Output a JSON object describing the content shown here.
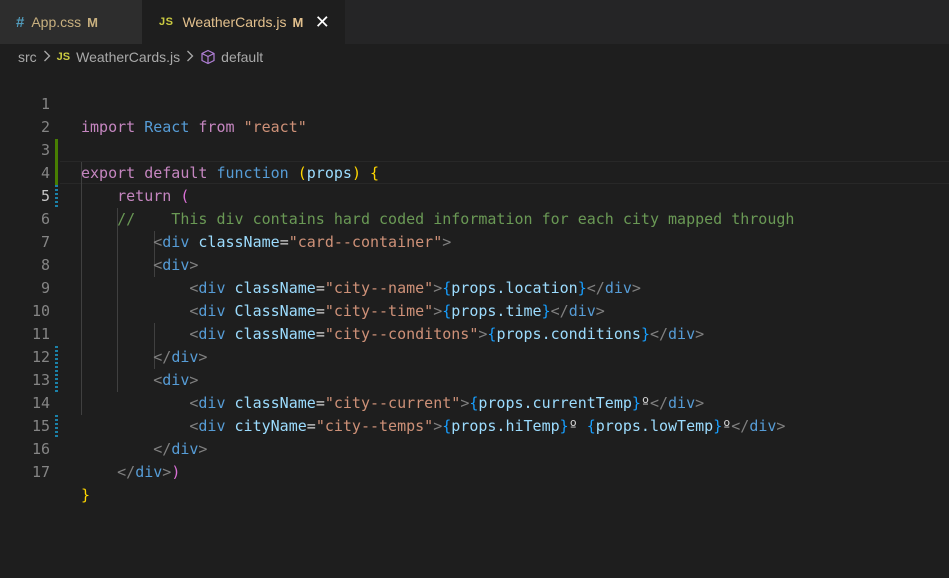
{
  "tabs": [
    {
      "icon": "css-file-icon",
      "glyph": "#",
      "name": "App.css",
      "status": "M",
      "active": false
    },
    {
      "icon": "js-file-icon",
      "glyph": "JS",
      "name": "WeatherCards.js",
      "status": "M",
      "active": true,
      "close": "✕"
    }
  ],
  "breadcrumb": {
    "folder": "src",
    "file_glyph": "JS",
    "file": "WeatherCards.js",
    "symbol": "default"
  },
  "line_numbers": [
    "1",
    "2",
    "3",
    "4",
    "5",
    "6",
    "7",
    "8",
    "9",
    "10",
    "11",
    "12",
    "13",
    "14",
    "15",
    "16",
    "17"
  ],
  "code": {
    "l1_import": "import",
    "l1_react": "React",
    "l1_from": "from",
    "l1_str": "\"react\"",
    "l3_export": "export",
    "l3_default": "default",
    "l3_function": "function",
    "l3_open": "(",
    "l3_props": "props",
    "l3_close": ")",
    "l3_brace": "{",
    "l4_return": "return",
    "l4_paren": "(",
    "l5_comment": "//    This div contains hard coded information for each city mapped through",
    "l6_attr": "className",
    "l6_val": "\"card--container\"",
    "l8_attr": "className",
    "l8_val": "\"city--name\"",
    "l8_expr": "props.location",
    "l9_attr": "ClassName",
    "l9_val": "\"city--time\"",
    "l9_expr": "props.time",
    "l10_attr": "className",
    "l10_val": "\"city--conditons\"",
    "l10_expr": "props.conditions",
    "l13_attr": "className",
    "l13_val": "\"city--current\"",
    "l13_expr": "props.currentTemp",
    "l13_deg": "º",
    "l14_attr": "cityName",
    "l14_val": "\"city--temps\"",
    "l14_expr1": "props.hiTemp",
    "l14_deg1": "º ",
    "l14_expr2": "props.lowTemp",
    "l14_deg2": "º",
    "tag_div": "div",
    "l16_tail": ")",
    "l17_brace": "}"
  },
  "colors": {
    "editor_bg": "#1e1e1e",
    "modified_tab_text": "#e2c08d",
    "keyword": "#c586c0",
    "string": "#ce9178",
    "comment": "#6a9955"
  }
}
